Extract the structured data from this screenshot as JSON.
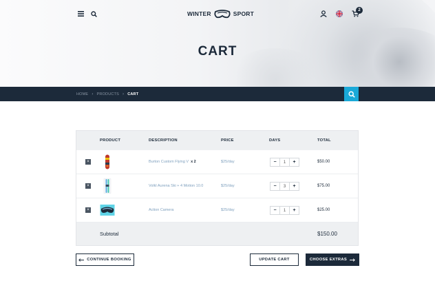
{
  "header": {
    "logo_left": "WINTER",
    "logo_right": "SPORT",
    "cart_count": "2",
    "page_title": "CART"
  },
  "breadcrumb": {
    "items": [
      "HOME",
      "PRODUCTS",
      "CART"
    ],
    "separator": "›"
  },
  "table": {
    "columns": [
      "PRODUCT",
      "DESCRIPTION",
      "PRICE",
      "DAYS",
      "TOTAL"
    ],
    "rows": [
      {
        "description": "Burton Custom Flying V",
        "qty": "x 2",
        "price": "$25/day",
        "days": "1",
        "total": "$50.00",
        "thumb": "snowboard-icon"
      },
      {
        "description": "Volkl Aurena Ski + 4 Motion 10.0",
        "qty": "",
        "price": "$25/day",
        "days": "3",
        "total": "$75.00",
        "thumb": "ski-icon"
      },
      {
        "description": "Action Camera",
        "qty": "",
        "price": "$25/day",
        "days": "1",
        "total": "$25.00",
        "thumb": "goggles-icon"
      }
    ],
    "stepper_minus": "−",
    "stepper_plus": "+",
    "remove_symbol": "×",
    "subtotal_label": "Subtotal",
    "subtotal_value": "$150.00"
  },
  "actions": {
    "continue_label": "CONTINUE BOOKING",
    "update_label": "UPDATE CART",
    "extras_label": "CHOOSE EXTRAS"
  },
  "colors": {
    "navy": "#1c2a3a",
    "accent": "#1aa9d8",
    "link": "#7fa0be"
  }
}
